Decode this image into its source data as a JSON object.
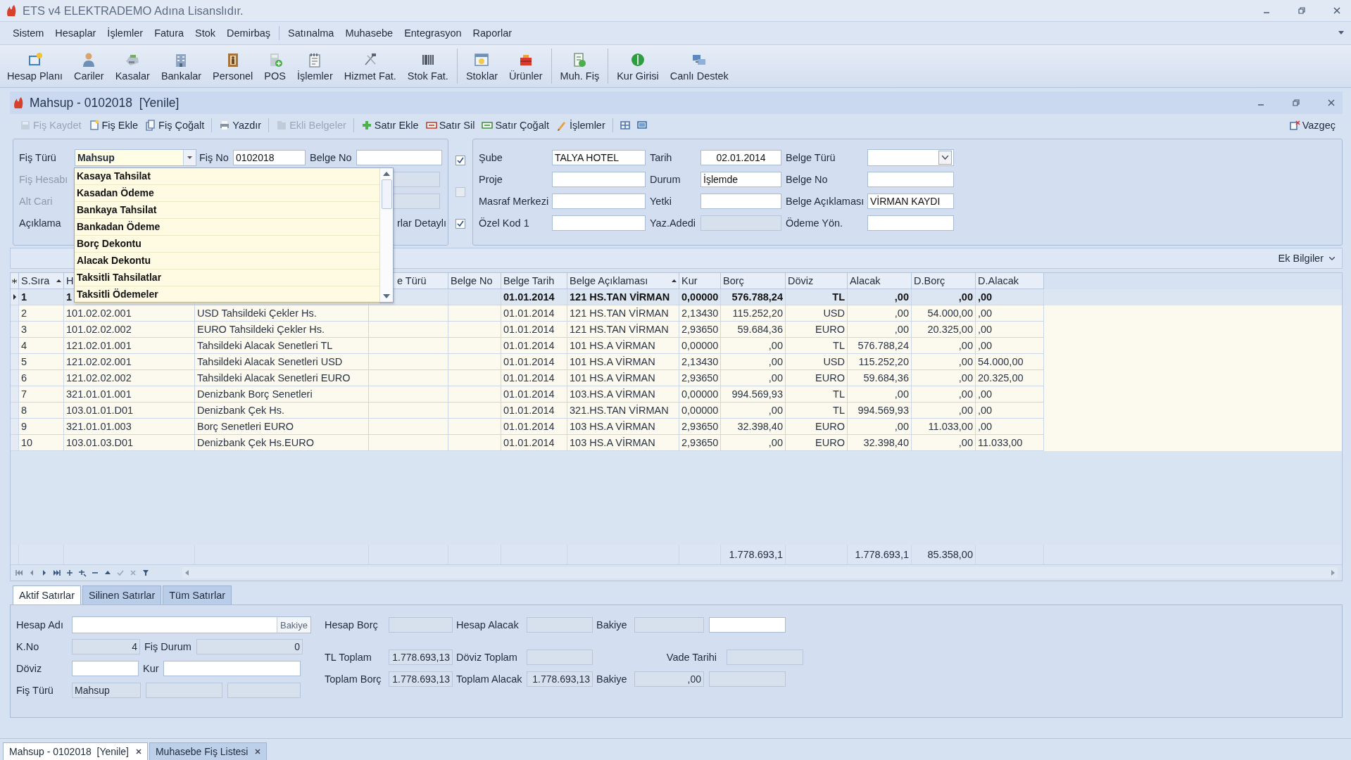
{
  "app_title": "ETS v4 ELEKTRADEMO Adına Lisanslıdır.",
  "menu": [
    {
      "label": "Sistem",
      "separator_before": false
    },
    {
      "label": "Hesaplar",
      "separator_before": false
    },
    {
      "label": "İşlemler",
      "separator_before": false
    },
    {
      "label": "Fatura",
      "separator_before": false
    },
    {
      "label": "Stok",
      "separator_before": false
    },
    {
      "label": "Demirbaş",
      "separator_before": false
    },
    {
      "label": "Satınalma",
      "separator_before": true
    },
    {
      "label": "Muhasebe",
      "separator_before": false
    },
    {
      "label": "Entegrasyon",
      "separator_before": false
    },
    {
      "label": "Raporlar",
      "separator_before": false
    }
  ],
  "toolbar": [
    {
      "label": "Hesap Planı",
      "separator_before": false
    },
    {
      "label": "Cariler",
      "separator_before": false
    },
    {
      "label": "Kasalar",
      "separator_before": false
    },
    {
      "label": "Bankalar",
      "separator_before": false
    },
    {
      "label": "Personel",
      "separator_before": false
    },
    {
      "label": "POS",
      "separator_before": false
    },
    {
      "label": "İşlemler",
      "separator_before": false
    },
    {
      "label": "Hizmet Fat.",
      "separator_before": false
    },
    {
      "label": "Stok Fat.",
      "separator_before": false
    },
    {
      "label": "Stoklar",
      "separator_before": true
    },
    {
      "label": "Ürünler",
      "separator_before": false
    },
    {
      "label": "Muh. Fiş",
      "separator_before": true
    },
    {
      "label": "Kur Girisi",
      "separator_before": true
    },
    {
      "label": "Canlı Destek",
      "separator_before": false
    }
  ],
  "document": {
    "title": "Mahsup - 0102018  [Yenile]",
    "actions": [
      {
        "label": "Fiş Kaydet",
        "disabled": true,
        "separator_before": false
      },
      {
        "label": "Fiş Ekle",
        "disabled": false,
        "separator_before": false
      },
      {
        "label": "Fiş Çoğalt",
        "disabled": false,
        "separator_before": false
      },
      {
        "label": "Yazdır",
        "disabled": false,
        "separator_before": true
      },
      {
        "label": "Ekli Belgeler",
        "disabled": true,
        "separator_before": true
      },
      {
        "label": "Satır Ekle",
        "disabled": false,
        "separator_before": true
      },
      {
        "label": "Satır Sil",
        "disabled": false,
        "separator_before": false
      },
      {
        "label": "Satır Çoğalt",
        "disabled": false,
        "separator_before": false
      },
      {
        "label": "İşlemler",
        "disabled": false,
        "separator_before": false
      }
    ],
    "cancel": "Vazgeç",
    "voucher": {
      "type_label": "Fiş Türü",
      "type_value": "Mahsup",
      "no_label": "Fiş No",
      "no_value": "0102018",
      "doc_no_label": "Belge No",
      "account_label": "Fiş Hesabı",
      "subaccount_label": "Alt Cari",
      "note_label": "Açıklama",
      "covered_text": "rlar Detaylı",
      "options": [
        "Kasaya Tahsilat",
        "Kasadan Ödeme",
        "Bankaya Tahsilat",
        "Bankadan Ödeme",
        "Borç Dekontu",
        "Alacak Dekontu",
        "Taksitli Tahsilatlar",
        "Taksitli Ödemeler"
      ]
    },
    "flags": [
      {
        "checked": true,
        "disabled": false
      },
      {
        "checked": false,
        "disabled": true
      },
      {
        "checked": true,
        "disabled": false
      }
    ],
    "details": [
      [
        {
          "label": "Şube",
          "value": "TALYA HOTEL",
          "kind": "text"
        },
        {
          "label": "Tarih",
          "value": "02.01.2014",
          "kind": "date"
        },
        {
          "label": "Belge Türü",
          "kind": "combo"
        }
      ],
      [
        {
          "label": "Proje",
          "kind": "text"
        },
        {
          "label": "Durum",
          "value": "İşlemde",
          "kind": "text"
        },
        {
          "label": "Belge No",
          "kind": "text"
        }
      ],
      [
        {
          "label": "Masraf Merkezi",
          "kind": "text"
        },
        {
          "label": "Yetki",
          "kind": "text"
        },
        {
          "label": "Belge Açıklaması",
          "value": "VİRMAN KAYDI",
          "kind": "text"
        }
      ],
      [
        {
          "label": "Özel Kod 1",
          "kind": "text"
        },
        {
          "label": "Yaz.Adedi",
          "kind": "readonly"
        },
        {
          "label": "Ödeme Yön.",
          "kind": "text"
        }
      ]
    ],
    "group_bar": "Ek Bilgiler",
    "table": {
      "columns": [
        {
          "label": "S.Sıra",
          "sorted": true
        },
        {
          "label": "H"
        },
        {
          "label": "e Türü",
          "sorted": false
        },
        {
          "label": "Belge No",
          "sorted": false
        },
        {
          "label": "Belge Tarih",
          "sorted": false
        },
        {
          "label": "Belge Açıklaması",
          "sorted": true
        },
        {
          "label": "Kur",
          "sorted": false
        },
        {
          "label": "Borç",
          "sorted": false
        },
        {
          "label": "Döviz",
          "sorted": false
        },
        {
          "label": "Alacak",
          "sorted": false
        },
        {
          "label": "D.Borç",
          "sorted": false
        },
        {
          "label": "D.Alacak",
          "sorted": false
        }
      ],
      "rows": [
        {
          "selected": true,
          "no": "1",
          "code": "1",
          "date": "01.01.2014",
          "description": "121 HS.TAN VİRMAN",
          "rate": "0,00000",
          "debit": "576.788,24",
          "currency": "TL",
          "credit": ",00",
          "fx_debit": ",00",
          "fx_credit": ",00"
        },
        {
          "selected": false,
          "no": "2",
          "code": "101.02.02.001",
          "name": "USD Tahsildeki Çekler Hs.",
          "date": "01.01.2014",
          "description": "121 HS.TAN VİRMAN",
          "rate": "2,13430",
          "debit": "115.252,20",
          "currency": "USD",
          "credit": ",00",
          "fx_debit": "54.000,00",
          "fx_credit": ",00"
        },
        {
          "selected": false,
          "no": "3",
          "code": "101.02.02.002",
          "name": "EURO Tahsildeki Çekler Hs.",
          "date": "01.01.2014",
          "description": "121 HS.TAN VİRMAN",
          "rate": "2,93650",
          "debit": "59.684,36",
          "currency": "EURO",
          "credit": ",00",
          "fx_debit": "20.325,00",
          "fx_credit": ",00"
        },
        {
          "selected": false,
          "no": "4",
          "code": "121.02.01.001",
          "name": "Tahsildeki Alacak Senetleri  TL",
          "date": "01.01.2014",
          "description": "101 HS.A VİRMAN",
          "rate": "0,00000",
          "debit": ",00",
          "currency": "TL",
          "credit": "576.788,24",
          "fx_debit": ",00",
          "fx_credit": ",00"
        },
        {
          "selected": false,
          "no": "5",
          "code": "121.02.02.001",
          "name": "Tahsildeki Alacak Senetleri USD",
          "date": "01.01.2014",
          "description": "101 HS.A VİRMAN",
          "rate": "2,13430",
          "debit": ",00",
          "currency": "USD",
          "credit": "115.252,20",
          "fx_debit": ",00",
          "fx_credit": "54.000,00"
        },
        {
          "selected": false,
          "no": "6",
          "code": "121.02.02.002",
          "name": "Tahsildeki Alacak Senetleri EURO",
          "date": "01.01.2014",
          "description": "101 HS.A VİRMAN",
          "rate": "2,93650",
          "debit": ",00",
          "currency": "EURO",
          "credit": "59.684,36",
          "fx_debit": ",00",
          "fx_credit": "20.325,00"
        },
        {
          "selected": false,
          "no": "7",
          "code": "321.01.01.001",
          "name": "Denizbank Borç Senetleri",
          "date": "01.01.2014",
          "description": "103.HS.A VİRMAN",
          "rate": "0,00000",
          "debit": "994.569,93",
          "currency": "TL",
          "credit": ",00",
          "fx_debit": ",00",
          "fx_credit": ",00"
        },
        {
          "selected": false,
          "no": "8",
          "code": "103.01.01.D01",
          "name": "Denizbank Çek Hs.",
          "date": "01.01.2014",
          "description": "321.HS.TAN VİRMAN",
          "rate": "0,00000",
          "debit": ",00",
          "currency": "TL",
          "credit": "994.569,93",
          "fx_debit": ",00",
          "fx_credit": ",00"
        },
        {
          "selected": false,
          "no": "9",
          "code": "321.01.01.003",
          "name": "Borç Senetleri EURO",
          "date": "01.01.2014",
          "description": "103 HS.A VİRMAN",
          "rate": "2,93650",
          "debit": "32.398,40",
          "currency": "EURO",
          "credit": ",00",
          "fx_debit": "11.033,00",
          "fx_credit": ",00"
        },
        {
          "selected": false,
          "no": "10",
          "code": "103.01.03.D01",
          "name": "Denizbank Çek Hs.EURO",
          "date": "01.01.2014",
          "description": "103 HS.A VİRMAN",
          "rate": "2,93650",
          "debit": ",00",
          "currency": "EURO",
          "credit": "32.398,40",
          "fx_debit": ",00",
          "fx_credit": "11.033,00"
        }
      ],
      "totals": {
        "debit": "1.778.693,1",
        "credit": "1.778.693,1",
        "fx_debit": "85.358,00"
      }
    },
    "row_tabs": [
      {
        "label": "Aktif Satırlar",
        "selected": true
      },
      {
        "label": "Silinen Satırlar",
        "selected": false
      },
      {
        "label": "Tüm Satırlar",
        "selected": false
      }
    ],
    "summary": {
      "hesap_adi": {
        "label": "Hesap Adı",
        "button": "Bakiye"
      },
      "k_no": {
        "label": "K.No",
        "value": "4"
      },
      "fis_durum": {
        "label": "Fiş Durum",
        "value": "0"
      },
      "doviz": {
        "label": "Döviz"
      },
      "kur": {
        "label": "Kur"
      },
      "fis_turu": {
        "label": "Fiş Türü",
        "value": "Mahsup"
      },
      "hesap_borc": {
        "label": "Hesap Borç"
      },
      "hesap_alacak": {
        "label": "Hesap Alacak"
      },
      "bakiye_top": {
        "label": "Bakiye"
      },
      "tl_toplam": {
        "label": "TL Toplam",
        "value": "1.778.693,13"
      },
      "doviz_toplam": {
        "label": "Döviz Toplam"
      },
      "vade_tarihi": {
        "label": "Vade Tarihi"
      },
      "toplam_borc": {
        "label": "Toplam Borç",
        "value": "1.778.693,13"
      },
      "toplam_alacak": {
        "label": "Toplam Alacak",
        "value": "1.778.693,13"
      },
      "bakiye_bottom": {
        "label": "Bakiye",
        "value": ",00"
      }
    }
  },
  "window_tabs": [
    {
      "label": "Mahsup - 0102018  [Yenile]",
      "selected": true
    },
    {
      "label": "Muhasebe Fiş Listesi",
      "selected": false
    }
  ]
}
